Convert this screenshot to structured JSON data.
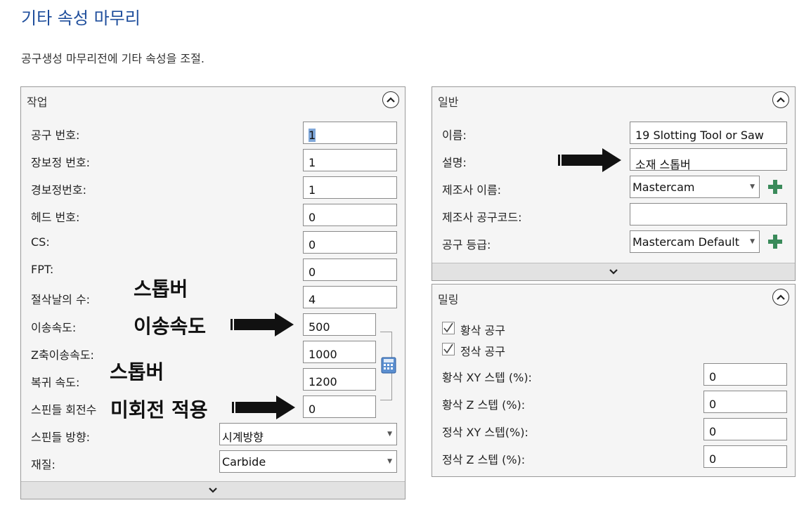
{
  "page": {
    "title": "기타 속성 마무리",
    "subtitle": "공구생성 마무리전에 기타 속성을 조절."
  },
  "job_panel": {
    "title": "작업",
    "fields": [
      {
        "label": "공구 번호:",
        "value": "1"
      },
      {
        "label": "장보정 번호:",
        "value": "1"
      },
      {
        "label": "경보정번호:",
        "value": "1"
      },
      {
        "label": "헤드 번호:",
        "value": "0"
      },
      {
        "label": "CS:",
        "value": "0"
      },
      {
        "label": "FPT:",
        "value": "0"
      },
      {
        "label": "절삭날의 수:",
        "value": "4"
      },
      {
        "label": "이송속도:",
        "value": "500"
      },
      {
        "label": "Z축이송속도:",
        "value": "1000"
      },
      {
        "label": "복귀 속도:",
        "value": "1200"
      },
      {
        "label": "스핀들 회전수",
        "value": "0"
      }
    ],
    "spindle_direction": {
      "label": "스핀들 방향:",
      "value": "시계방향"
    },
    "material": {
      "label": "재질:",
      "value": "Carbide"
    }
  },
  "general_panel": {
    "title": "일반",
    "name": {
      "label": "이름:",
      "value": "19 Slotting Tool or Saw"
    },
    "description": {
      "label": "설명:",
      "value": "소재 스톱버"
    },
    "manufacturer": {
      "label": "제조사 이름:",
      "value": "Mastercam"
    },
    "manufacturer_code": {
      "label": "제조사 공구코드:",
      "value": ""
    },
    "tool_grade": {
      "label": "공구 등급:",
      "value": "Mastercam Default"
    }
  },
  "milling_panel": {
    "title": "밀링",
    "roughing_tool": {
      "label": "황삭 공구",
      "checked": true
    },
    "finishing_tool": {
      "label": "정삭 공구",
      "checked": true
    },
    "fields": [
      {
        "label": "황삭 XY 스텝 (%):",
        "value": "0"
      },
      {
        "label": "황삭 Z 스텝 (%):",
        "value": "0"
      },
      {
        "label": "정삭 XY 스텝(%):",
        "value": "0"
      },
      {
        "label": "정삭 Z 스텝 (%):",
        "value": "0"
      }
    ]
  },
  "annotations": {
    "label1": "스톱버",
    "label2": "이송속도",
    "label3": "스톱버",
    "label4": "미회전 적용"
  },
  "colors": {
    "title": "#1f4e9c",
    "plus": "#3a8a5a",
    "selection": "#7fa7d9"
  }
}
